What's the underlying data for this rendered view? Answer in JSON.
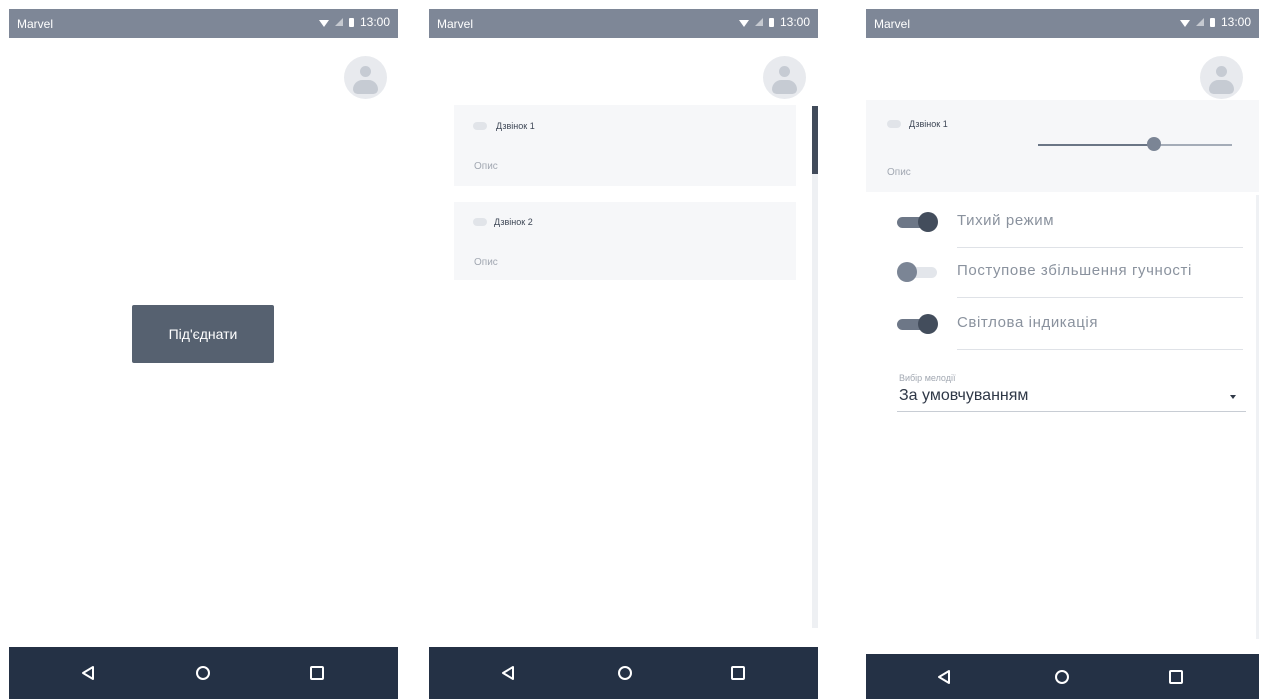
{
  "screens": [
    {
      "status_bar": {
        "carrier": "Marvel",
        "time": "13:00"
      },
      "connect_label": "Під'єднати",
      "navbar": {
        "icons": [
          "back-icon",
          "home-icon",
          "recents-icon"
        ]
      }
    },
    {
      "status_bar": {
        "carrier": "Marvel",
        "time": "13:00"
      },
      "bells": [
        {
          "name": "Дзвінок 1",
          "description": "Опис"
        },
        {
          "name": "Дзвінок 2",
          "description": "Опис"
        }
      ],
      "scroll_position": 0,
      "navbar": {
        "icons": [
          "back-icon",
          "home-icon",
          "recents-icon"
        ]
      }
    },
    {
      "status_bar": {
        "carrier": "Marvel",
        "time": "13:00"
      },
      "bell": {
        "name": "Дзвінок 1",
        "description": "Опис",
        "volume": 0.6
      },
      "settings": [
        {
          "label": "Тихий режим",
          "enabled": true
        },
        {
          "label": "Поступове збільшення гучності",
          "enabled": false
        },
        {
          "label": "Світлова індикація",
          "enabled": true
        }
      ],
      "melody": {
        "label": "Вибір мелодії",
        "value": "За умовчуванням"
      },
      "navbar": {
        "icons": [
          "back-icon",
          "home-icon",
          "recents-icon"
        ]
      }
    }
  ],
  "colors": {
    "status_bar": "#7e8797",
    "navbar": "#243145",
    "button": "#566170",
    "toggle_on": "#434d5c",
    "toggle_off": "#7b8595"
  }
}
